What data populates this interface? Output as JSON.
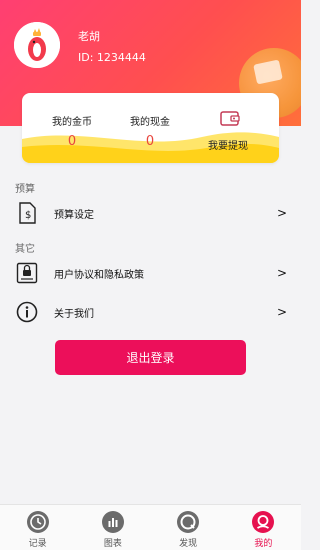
{
  "profile": {
    "name": "老胡",
    "id_text": "ID: 1234444"
  },
  "wallet": {
    "coins_label": "我的金币",
    "coins_value": "0",
    "cash_label": "我的现金",
    "cash_value": "0",
    "withdraw_label": "我要提现"
  },
  "sections": {
    "budget_title": "预算",
    "budget_setting": "预算设定",
    "other_title": "其它",
    "agreement": "用户协议和隐私政策",
    "about": "关于我们",
    "chevron": ">"
  },
  "logout_label": "退出登录",
  "nav": {
    "items": [
      {
        "label": "记录",
        "icon": "clock-icon"
      },
      {
        "label": "图表",
        "icon": "chart-icon"
      },
      {
        "label": "发现",
        "icon": "discover-icon"
      },
      {
        "label": "我的",
        "icon": "profile-icon"
      }
    ],
    "active_index": 3
  },
  "colors": {
    "header_gradient_start": "#ff3f72",
    "header_gradient_end": "#ff6f3a",
    "accent": "#ec0f5a",
    "value_red": "#e8453c",
    "nav_active": "#e6114f",
    "nav_inactive": "#6b6b6b"
  }
}
